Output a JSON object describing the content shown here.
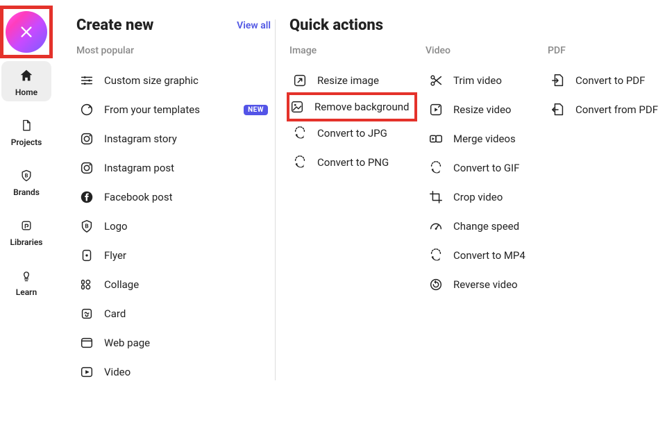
{
  "sidebar": {
    "items": [
      {
        "label": "Home"
      },
      {
        "label": "Projects"
      },
      {
        "label": "Brands"
      },
      {
        "label": "Libraries"
      },
      {
        "label": "Learn"
      }
    ]
  },
  "create": {
    "title": "Create new",
    "view_all": "View all",
    "subhead": "Most popular",
    "badge_new": "NEW",
    "items": [
      {
        "label": "Custom size graphic"
      },
      {
        "label": "From your templates"
      },
      {
        "label": "Instagram story"
      },
      {
        "label": "Instagram post"
      },
      {
        "label": "Facebook post"
      },
      {
        "label": "Logo"
      },
      {
        "label": "Flyer"
      },
      {
        "label": "Collage"
      },
      {
        "label": "Card"
      },
      {
        "label": "Web page"
      },
      {
        "label": "Video"
      }
    ]
  },
  "quick": {
    "title": "Quick actions",
    "columns": {
      "image": {
        "head": "Image",
        "items": [
          {
            "label": "Resize image"
          },
          {
            "label": "Remove background"
          },
          {
            "label": "Convert to JPG"
          },
          {
            "label": "Convert to PNG"
          }
        ]
      },
      "video": {
        "head": "Video",
        "items": [
          {
            "label": "Trim video"
          },
          {
            "label": "Resize video"
          },
          {
            "label": "Merge videos"
          },
          {
            "label": "Convert to GIF"
          },
          {
            "label": "Crop video"
          },
          {
            "label": "Change speed"
          },
          {
            "label": "Convert to MP4"
          },
          {
            "label": "Reverse video"
          }
        ]
      },
      "pdf": {
        "head": "PDF",
        "items": [
          {
            "label": "Convert to PDF"
          },
          {
            "label": "Convert from PDF"
          }
        ]
      }
    }
  }
}
